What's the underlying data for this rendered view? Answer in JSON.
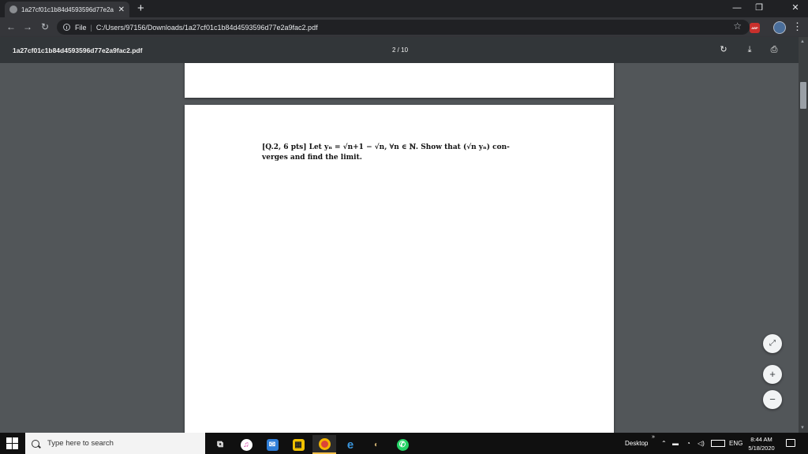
{
  "browser": {
    "tab_title": "1a27cf01c1b84d4593596d77e2a",
    "tab_close": "✕",
    "new_tab": "+",
    "window_controls": {
      "minimize": "—",
      "restore": "❐",
      "close": "✕"
    },
    "nav": {
      "back": "←",
      "forward": "→",
      "reload": "↻"
    },
    "omnibox": {
      "scheme_label": "File",
      "separator": "|",
      "url": "C:/Users/97156/Downloads/1a27cf01c1b84d4593596d77e2a9fac2.pdf"
    },
    "bookmark_star": "☆",
    "extension_abp": "ABP",
    "menu": "⋮"
  },
  "pdf_toolbar": {
    "filename": "1a27cf01c1b84d4593596d77e2a9fac2.pdf",
    "page_indicator": "2 / 10",
    "rotate": "↻",
    "download": "⤓",
    "print": "⎙"
  },
  "document": {
    "question_line1": "[Q.2, 6 pts] Let yₙ = √n+1 − √n, ∀n ∈ ℕ. Show that (√n yₙ) con-",
    "question_line2": "verges and find the limit."
  },
  "zoom": {
    "fit": "⤢",
    "in": "+",
    "out": "−"
  },
  "taskbar": {
    "search_placeholder": "Type here to search",
    "desktop_label": "Desktop",
    "overflow": "»",
    "language": "ENG",
    "time": "8:44 AM",
    "date": "5/18/2020"
  },
  "colors": {
    "tabstrip": "#202124",
    "toolbar": "#35363a",
    "pdf_toolbar": "#323639",
    "viewer_bg": "#525659",
    "taskbar": "#101010",
    "active_app_underline": "#f5c04a"
  }
}
